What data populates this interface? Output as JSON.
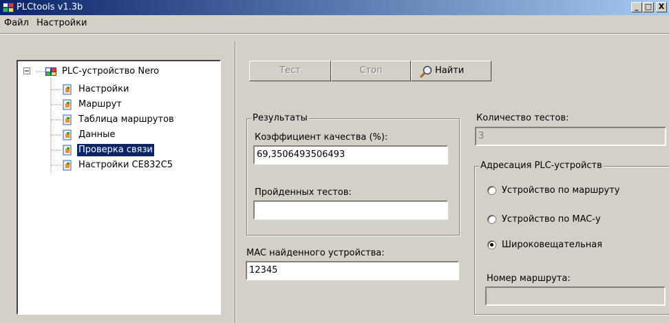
{
  "window": {
    "title": "PLCtools v1.3b",
    "controls": {
      "minimize": "_",
      "maximize": "□",
      "close": "X"
    }
  },
  "menu": {
    "items": [
      "Файл",
      "Настройки"
    ]
  },
  "tree": {
    "root": "PLC-устройство Nero",
    "items": [
      "Настройки",
      "Маршрут",
      "Таблица маршрутов",
      "Данные",
      "Проверка связи",
      "Настройки CE832C5"
    ],
    "selected_index": 4
  },
  "toolbar": {
    "test": "Тест",
    "stop": "Стоп",
    "find": "Найти"
  },
  "results": {
    "caption": "Результаты",
    "quality_label": "Коэффициент качества (%):",
    "quality_value": "69,3506493506493",
    "passed_label": "Пройденных тестов:",
    "passed_value": ""
  },
  "mac": {
    "label": "MAC найденного устройства:",
    "value": "12345"
  },
  "tests": {
    "label": "Количество тестов:",
    "value": "3"
  },
  "addressing": {
    "caption": "Адресация PLC-устройств",
    "options": [
      "Устройство по маршруту",
      "Устройство по MAC-у",
      "Широковещательная"
    ],
    "selected_index": 2,
    "route_label": "Номер маршрута:",
    "route_value": ""
  },
  "colors": {
    "titlebar_start": "#0a246a",
    "titlebar_end": "#a6caf0",
    "face": "#d4d0c8",
    "selection": "#0a246a"
  }
}
